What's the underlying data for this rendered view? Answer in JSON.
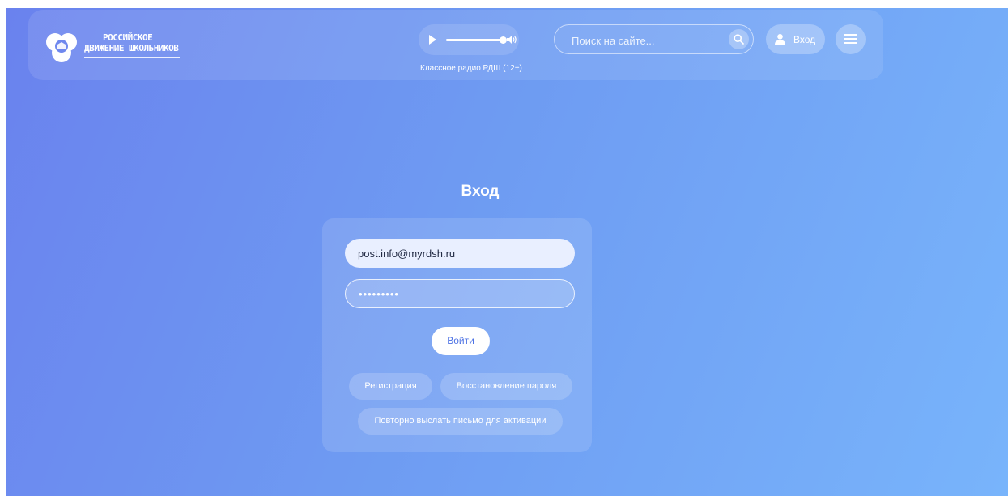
{
  "header": {
    "logo": {
      "line1": "РОССИЙСКОЕ",
      "line2": "ДВИЖЕНИЕ ШКОЛЬНИКОВ"
    },
    "player": {
      "caption": "Классное радио РДШ (12+)",
      "progress": 0.95,
      "icons": {
        "play": "play-icon",
        "volume": "volume-icon"
      }
    },
    "search": {
      "placeholder": "Поиск на сайте...",
      "icon": "search-icon"
    },
    "login_label": "Вход",
    "menu_icon": "hamburger-menu-icon"
  },
  "main": {
    "title": "Вход",
    "form": {
      "email_value": "post.info@myrdsh.ru",
      "password_value": "•••••••••",
      "submit_label": "Войти",
      "links": {
        "register": "Регистрация",
        "recover": "Восстановление пароля",
        "resend": "Повторно выслать письмо для активации"
      }
    }
  },
  "colors": {
    "gradient_start": "#6a82ee",
    "gradient_end": "#78b4fb",
    "accent_text": "#4e73e4"
  }
}
